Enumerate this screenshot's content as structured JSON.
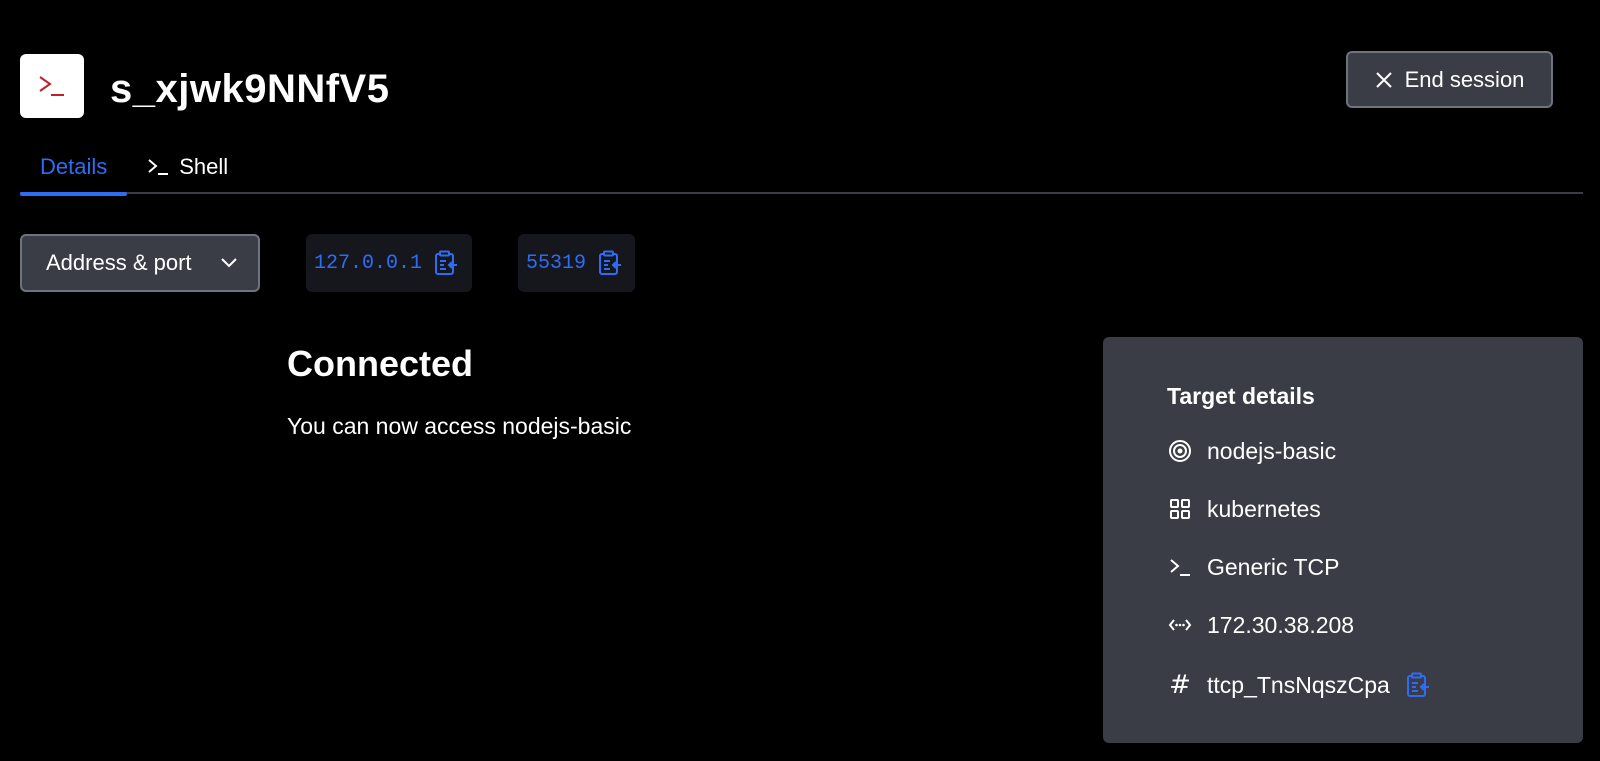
{
  "header": {
    "session_id": "s_xjwk9NNfV5",
    "end_session_label": "End session"
  },
  "tabs": [
    {
      "label": "Details",
      "active": true
    },
    {
      "label": "Shell",
      "active": false,
      "icon": "terminal-icon"
    }
  ],
  "connection": {
    "select_label": "Address & port",
    "address": "127.0.0.1",
    "port": "55319",
    "status_title": "Connected",
    "status_message": "You can now access nodejs-basic"
  },
  "target_details": {
    "title": "Target details",
    "name": "nodejs-basic",
    "scope": "kubernetes",
    "type": "Generic TCP",
    "host": "172.30.38.208",
    "id": "ttcp_TnsNqszCpa"
  },
  "colors": {
    "accent": "#2f6cf5",
    "background": "#000000",
    "panel": "#3a3d46",
    "icon_red": "#c21f2c"
  }
}
